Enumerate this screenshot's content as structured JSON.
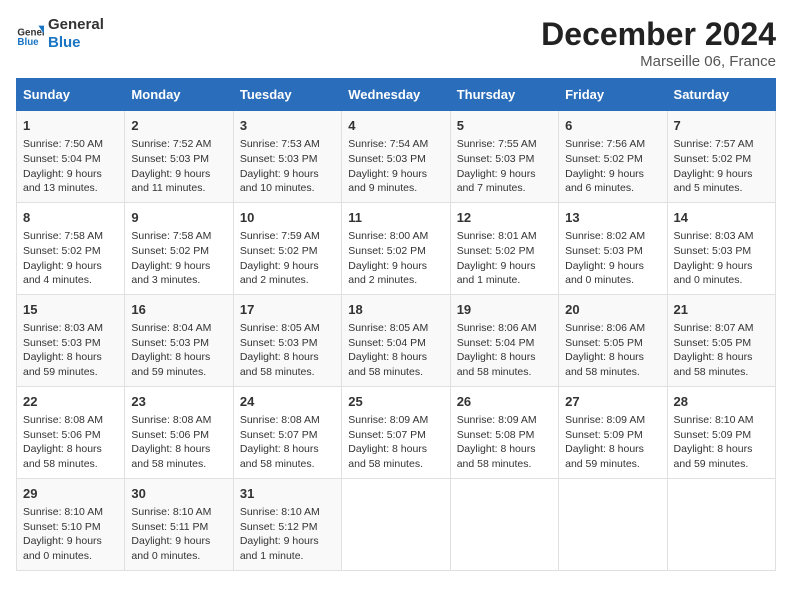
{
  "header": {
    "logo_line1": "General",
    "logo_line2": "Blue",
    "title": "December 2024",
    "subtitle": "Marseille 06, France"
  },
  "weekdays": [
    "Sunday",
    "Monday",
    "Tuesday",
    "Wednesday",
    "Thursday",
    "Friday",
    "Saturday"
  ],
  "weeks": [
    [
      {
        "day": "1",
        "lines": [
          "Sunrise: 7:50 AM",
          "Sunset: 5:04 PM",
          "Daylight: 9 hours",
          "and 13 minutes."
        ]
      },
      {
        "day": "2",
        "lines": [
          "Sunrise: 7:52 AM",
          "Sunset: 5:03 PM",
          "Daylight: 9 hours",
          "and 11 minutes."
        ]
      },
      {
        "day": "3",
        "lines": [
          "Sunrise: 7:53 AM",
          "Sunset: 5:03 PM",
          "Daylight: 9 hours",
          "and 10 minutes."
        ]
      },
      {
        "day": "4",
        "lines": [
          "Sunrise: 7:54 AM",
          "Sunset: 5:03 PM",
          "Daylight: 9 hours",
          "and 9 minutes."
        ]
      },
      {
        "day": "5",
        "lines": [
          "Sunrise: 7:55 AM",
          "Sunset: 5:03 PM",
          "Daylight: 9 hours",
          "and 7 minutes."
        ]
      },
      {
        "day": "6",
        "lines": [
          "Sunrise: 7:56 AM",
          "Sunset: 5:02 PM",
          "Daylight: 9 hours",
          "and 6 minutes."
        ]
      },
      {
        "day": "7",
        "lines": [
          "Sunrise: 7:57 AM",
          "Sunset: 5:02 PM",
          "Daylight: 9 hours",
          "and 5 minutes."
        ]
      }
    ],
    [
      {
        "day": "8",
        "lines": [
          "Sunrise: 7:58 AM",
          "Sunset: 5:02 PM",
          "Daylight: 9 hours",
          "and 4 minutes."
        ]
      },
      {
        "day": "9",
        "lines": [
          "Sunrise: 7:58 AM",
          "Sunset: 5:02 PM",
          "Daylight: 9 hours",
          "and 3 minutes."
        ]
      },
      {
        "day": "10",
        "lines": [
          "Sunrise: 7:59 AM",
          "Sunset: 5:02 PM",
          "Daylight: 9 hours",
          "and 2 minutes."
        ]
      },
      {
        "day": "11",
        "lines": [
          "Sunrise: 8:00 AM",
          "Sunset: 5:02 PM",
          "Daylight: 9 hours",
          "and 2 minutes."
        ]
      },
      {
        "day": "12",
        "lines": [
          "Sunrise: 8:01 AM",
          "Sunset: 5:02 PM",
          "Daylight: 9 hours",
          "and 1 minute."
        ]
      },
      {
        "day": "13",
        "lines": [
          "Sunrise: 8:02 AM",
          "Sunset: 5:03 PM",
          "Daylight: 9 hours",
          "and 0 minutes."
        ]
      },
      {
        "day": "14",
        "lines": [
          "Sunrise: 8:03 AM",
          "Sunset: 5:03 PM",
          "Daylight: 9 hours",
          "and 0 minutes."
        ]
      }
    ],
    [
      {
        "day": "15",
        "lines": [
          "Sunrise: 8:03 AM",
          "Sunset: 5:03 PM",
          "Daylight: 8 hours",
          "and 59 minutes."
        ]
      },
      {
        "day": "16",
        "lines": [
          "Sunrise: 8:04 AM",
          "Sunset: 5:03 PM",
          "Daylight: 8 hours",
          "and 59 minutes."
        ]
      },
      {
        "day": "17",
        "lines": [
          "Sunrise: 8:05 AM",
          "Sunset: 5:03 PM",
          "Daylight: 8 hours",
          "and 58 minutes."
        ]
      },
      {
        "day": "18",
        "lines": [
          "Sunrise: 8:05 AM",
          "Sunset: 5:04 PM",
          "Daylight: 8 hours",
          "and 58 minutes."
        ]
      },
      {
        "day": "19",
        "lines": [
          "Sunrise: 8:06 AM",
          "Sunset: 5:04 PM",
          "Daylight: 8 hours",
          "and 58 minutes."
        ]
      },
      {
        "day": "20",
        "lines": [
          "Sunrise: 8:06 AM",
          "Sunset: 5:05 PM",
          "Daylight: 8 hours",
          "and 58 minutes."
        ]
      },
      {
        "day": "21",
        "lines": [
          "Sunrise: 8:07 AM",
          "Sunset: 5:05 PM",
          "Daylight: 8 hours",
          "and 58 minutes."
        ]
      }
    ],
    [
      {
        "day": "22",
        "lines": [
          "Sunrise: 8:08 AM",
          "Sunset: 5:06 PM",
          "Daylight: 8 hours",
          "and 58 minutes."
        ]
      },
      {
        "day": "23",
        "lines": [
          "Sunrise: 8:08 AM",
          "Sunset: 5:06 PM",
          "Daylight: 8 hours",
          "and 58 minutes."
        ]
      },
      {
        "day": "24",
        "lines": [
          "Sunrise: 8:08 AM",
          "Sunset: 5:07 PM",
          "Daylight: 8 hours",
          "and 58 minutes."
        ]
      },
      {
        "day": "25",
        "lines": [
          "Sunrise: 8:09 AM",
          "Sunset: 5:07 PM",
          "Daylight: 8 hours",
          "and 58 minutes."
        ]
      },
      {
        "day": "26",
        "lines": [
          "Sunrise: 8:09 AM",
          "Sunset: 5:08 PM",
          "Daylight: 8 hours",
          "and 58 minutes."
        ]
      },
      {
        "day": "27",
        "lines": [
          "Sunrise: 8:09 AM",
          "Sunset: 5:09 PM",
          "Daylight: 8 hours",
          "and 59 minutes."
        ]
      },
      {
        "day": "28",
        "lines": [
          "Sunrise: 8:10 AM",
          "Sunset: 5:09 PM",
          "Daylight: 8 hours",
          "and 59 minutes."
        ]
      }
    ],
    [
      {
        "day": "29",
        "lines": [
          "Sunrise: 8:10 AM",
          "Sunset: 5:10 PM",
          "Daylight: 9 hours",
          "and 0 minutes."
        ]
      },
      {
        "day": "30",
        "lines": [
          "Sunrise: 8:10 AM",
          "Sunset: 5:11 PM",
          "Daylight: 9 hours",
          "and 0 minutes."
        ]
      },
      {
        "day": "31",
        "lines": [
          "Sunrise: 8:10 AM",
          "Sunset: 5:12 PM",
          "Daylight: 9 hours",
          "and 1 minute."
        ]
      },
      null,
      null,
      null,
      null
    ]
  ]
}
